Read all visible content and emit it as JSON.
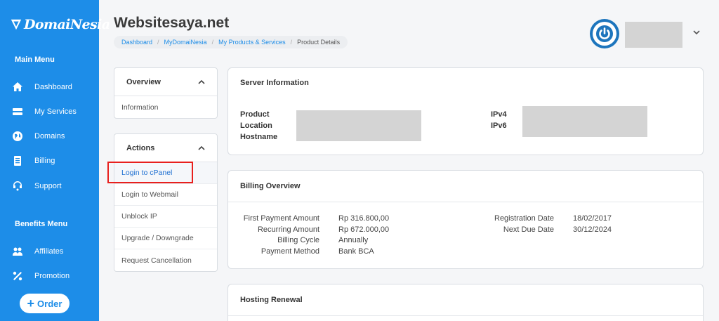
{
  "brand": {
    "name": "DomaiNesia"
  },
  "sidebar": {
    "main_menu_label": "Main Menu",
    "main_items": [
      {
        "label": "Dashboard",
        "icon": "home-icon"
      },
      {
        "label": "My Services",
        "icon": "server-icon"
      },
      {
        "label": "Domains",
        "icon": "globe-icon"
      },
      {
        "label": "Billing",
        "icon": "invoice-icon"
      },
      {
        "label": "Support",
        "icon": "headset-icon"
      }
    ],
    "benefits_menu_label": "Benefits Menu",
    "benefit_items": [
      {
        "label": "Affiliates",
        "icon": "affiliates-icon"
      },
      {
        "label": "Promotion",
        "icon": "percent-icon"
      }
    ],
    "order_button": "Order"
  },
  "header": {
    "title": "Websitesaya.net",
    "breadcrumb": [
      "Dashboard",
      "MyDomaiNesia",
      "My Products & Services",
      "Product Details"
    ]
  },
  "overview_panel": {
    "title": "Overview",
    "items": [
      "Information"
    ]
  },
  "actions_panel": {
    "title": "Actions",
    "items": [
      "Login to cPanel",
      "Login to Webmail",
      "Unblock IP",
      "Upgrade / Downgrade",
      "Request Cancellation"
    ]
  },
  "server_info": {
    "title": "Server Information",
    "labels": [
      "Product",
      "Location",
      "Hostname"
    ],
    "ip_labels": [
      "IPv4",
      "IPv6"
    ]
  },
  "billing": {
    "title": "Billing Overview",
    "left_labels": [
      "First Payment Amount",
      "Recurring Amount",
      "Billing Cycle",
      "Payment Method"
    ],
    "left_values": [
      "Rp 316.800,00",
      "Rp 672.000,00",
      "Annually",
      "Bank BCA"
    ],
    "right_labels": [
      "Registration Date",
      "Next Due Date"
    ],
    "right_values": [
      "18/02/2017",
      "30/12/2024"
    ]
  },
  "hosting_renewal": {
    "title": "Hosting Renewal"
  },
  "colors": {
    "brand_blue": "#1d8de8",
    "highlight_red": "#e8201d",
    "redaction_gray": "#d4d4d4"
  }
}
